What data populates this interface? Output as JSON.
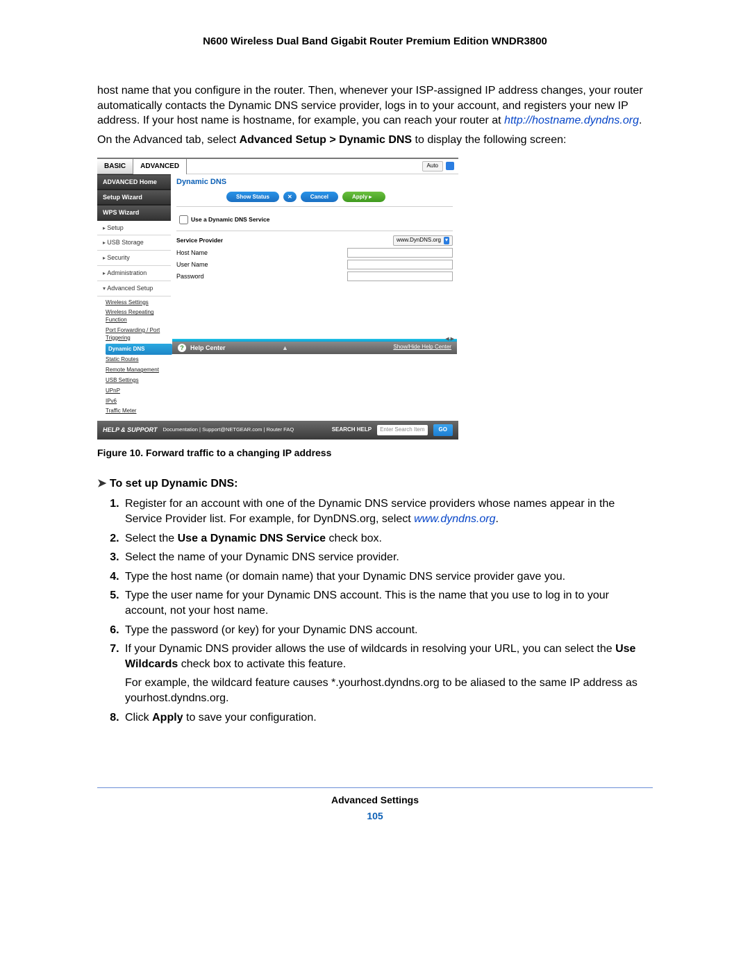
{
  "doc_header": "N600 Wireless Dual Band Gigabit Router Premium Edition WNDR3800",
  "intro": {
    "p1a": "host name that you configure in the router. Then, whenever your ISP-assigned IP address changes, your router automatically contacts the Dynamic DNS service provider, logs in to your account, and registers your new IP address. If your host name is hostname, for example, you can reach your router at ",
    "p1_link": "http://hostname.dyndns.org",
    "p1b": ".",
    "p2a": "On the Advanced tab, select ",
    "p2_bold": "Advanced Setup > Dynamic DNS",
    "p2b": " to display the following screen:"
  },
  "screenshot": {
    "tabs": {
      "basic": "BASIC",
      "advanced": "ADVANCED",
      "auto": "Auto"
    },
    "sidebar": {
      "home": "ADVANCED Home",
      "setup_wizard": "Setup Wizard",
      "wps_wizard": "WPS Wizard",
      "setup": "Setup",
      "usb": "USB Storage",
      "security": "Security",
      "admin": "Administration",
      "adv_setup": "Advanced Setup",
      "subs": {
        "wireless": "Wireless Settings",
        "repeating": "Wireless Repeating Function",
        "portfwd": "Port Forwarding / Port Triggering",
        "ddns": "Dynamic DNS",
        "static": "Static Routes",
        "remote": "Remote Management",
        "usb_set": "USB Settings",
        "upnp": "UPnP",
        "ipv6": "IPv6",
        "traffic": "Traffic Meter"
      }
    },
    "pane": {
      "title": "Dynamic DNS",
      "show_status": "Show Status",
      "x": "✕",
      "cancel": "Cancel",
      "apply": "Apply",
      "use_ddns": "Use a Dynamic DNS Service",
      "service_provider": "Service Provider",
      "provider_value": "www.DynDNS.org",
      "host": "Host Name",
      "user": "User Name",
      "pass": "Password"
    },
    "help_center": {
      "label": "Help Center",
      "toggle": "Show/Hide Help Center"
    },
    "footer": {
      "help_support": "HELP & SUPPORT",
      "links": "Documentation | Support@NETGEAR.com | Router FAQ",
      "search_help": "SEARCH HELP",
      "placeholder": "Enter Search Item",
      "go": "GO"
    }
  },
  "caption": "Figure 10. Forward traffic to a changing IP address",
  "proc_head": "To set up Dynamic DNS:",
  "steps": {
    "s1a": "Register for an account with one of the Dynamic DNS service providers whose names appear in the Service Provider list. For example, for DynDNS.org, select ",
    "s1_link": "www.dyndns.org",
    "s1b": ".",
    "s2a": "Select the ",
    "s2_bold": "Use a Dynamic DNS Service",
    "s2b": " check box.",
    "s3": "Select the name of your Dynamic DNS service provider.",
    "s4": "Type the host name (or domain name) that your Dynamic DNS service provider gave you.",
    "s5": "Type the user name for your Dynamic DNS account. This is the name that you use to log in to your account, not your host name.",
    "s6": "Type the password (or key) for your Dynamic DNS account.",
    "s7a": "If your Dynamic DNS provider allows the use of wildcards in resolving your URL, you can select the ",
    "s7_bold": "Use Wildcards",
    "s7b": " check box to activate this feature.",
    "s7_p2": "For example, the wildcard feature causes *.yourhost.dyndns.org to be aliased to the same IP address as yourhost.dyndns.org.",
    "s8a": "Click ",
    "s8_bold": "Apply",
    "s8b": " to save your configuration."
  },
  "footer": {
    "section": "Advanced Settings",
    "page": "105"
  }
}
